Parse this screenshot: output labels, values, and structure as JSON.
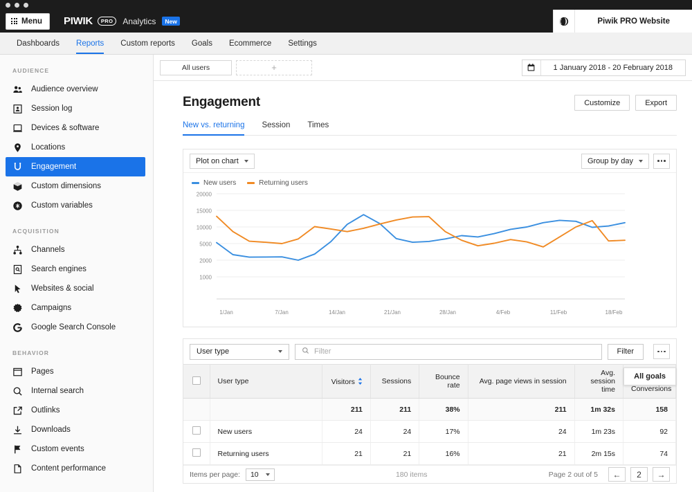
{
  "window": {
    "dots": 3
  },
  "topbar": {
    "menu_label": "Menu",
    "brand_piwik": "PIWIK",
    "brand_pro": "PRO",
    "brand_product": "Analytics",
    "brand_badge": "New",
    "globe_icon": "globe-icon",
    "site_name": "Piwik PRO Website"
  },
  "nav": {
    "tabs": [
      {
        "label": "Dashboards",
        "active": false
      },
      {
        "label": "Reports",
        "active": true
      },
      {
        "label": "Custom reports",
        "active": false
      },
      {
        "label": "Goals",
        "active": false
      },
      {
        "label": "Ecommerce",
        "active": false
      },
      {
        "label": "Settings",
        "active": false
      }
    ]
  },
  "sidebar": {
    "groups": [
      {
        "title": "AUDIENCE",
        "items": [
          {
            "label": "Audience overview",
            "icon": "users-icon",
            "active": false
          },
          {
            "label": "Session log",
            "icon": "session-log-icon",
            "active": false
          },
          {
            "label": "Devices & software",
            "icon": "device-icon",
            "active": false
          },
          {
            "label": "Locations",
            "icon": "pin-icon",
            "active": false
          },
          {
            "label": "Engagement",
            "icon": "engagement-icon",
            "active": true
          },
          {
            "label": "Custom dimensions",
            "icon": "cube-icon",
            "active": false
          },
          {
            "label": "Custom variables",
            "icon": "variables-icon",
            "active": false
          }
        ]
      },
      {
        "title": "ACQUISITION",
        "items": [
          {
            "label": "Channels",
            "icon": "channels-icon",
            "active": false
          },
          {
            "label": "Search engines",
            "icon": "search-engines-icon",
            "active": false
          },
          {
            "label": "Websites & social",
            "icon": "cursor-icon",
            "active": false
          },
          {
            "label": "Campaigns",
            "icon": "campaigns-icon",
            "active": false
          },
          {
            "label": "Google Search Console",
            "icon": "google-icon",
            "active": false
          }
        ]
      },
      {
        "title": "BEHAVIOR",
        "items": [
          {
            "label": "Pages",
            "icon": "pages-icon",
            "active": false
          },
          {
            "label": "Internal search",
            "icon": "search-icon",
            "active": false
          },
          {
            "label": "Outlinks",
            "icon": "outlink-icon",
            "active": false
          },
          {
            "label": "Downloads",
            "icon": "download-icon",
            "active": false
          },
          {
            "label": "Custom events",
            "icon": "flag-icon",
            "active": false
          },
          {
            "label": "Content performance",
            "icon": "document-icon",
            "active": false
          }
        ]
      }
    ]
  },
  "filterbar": {
    "segment_all": "All users",
    "segment_add": "+",
    "calendar_icon": "calendar-icon",
    "date_range": "1 January 2018 - 20 February 2018"
  },
  "page": {
    "title": "Engagement",
    "customize_label": "Customize",
    "export_label": "Export",
    "subtabs": [
      {
        "label": "New vs. returning",
        "active": true
      },
      {
        "label": "Session",
        "active": false
      },
      {
        "label": "Times",
        "active": false
      }
    ]
  },
  "chart_card": {
    "plot_select": "Plot on chart",
    "group_select": "Group by day",
    "more_icon": "kebab-icon"
  },
  "chart_data": {
    "type": "line",
    "title": "",
    "xlabel": "",
    "ylabel": "",
    "grid": true,
    "legend_position": "top-left",
    "x_tick_labels": [
      "1/Jan",
      "7/Jan",
      "14/Jan",
      "21/Jan",
      "28/Jan",
      "4/Feb",
      "11/Feb",
      "18/Feb"
    ],
    "y_tick_labels": [
      "20000",
      "15000",
      "10000",
      "5000",
      "2000",
      "1000"
    ],
    "y_tick_values": [
      20000,
      15000,
      10000,
      5000,
      2000,
      1000
    ],
    "y_scale": "nonlinear-custom",
    "series": [
      {
        "name": "New users",
        "color": "#3a8fe0",
        "values": [
          5300,
          3000,
          2550,
          2580,
          2600,
          2000,
          3100,
          5600,
          10800,
          13700,
          11000,
          6500,
          5400,
          5650,
          6400,
          7400,
          7000,
          8000,
          9300,
          10000,
          11300,
          12000,
          11700,
          9900,
          10300,
          11300
        ]
      },
      {
        "name": "Returning users",
        "color": "#f08a24",
        "values": [
          13200,
          8600,
          5700,
          5400,
          5000,
          6400,
          10100,
          9400,
          8600,
          9600,
          10900,
          12100,
          13000,
          13100,
          8600,
          6000,
          4600,
          5100,
          6200,
          5500,
          4400,
          7000,
          10000,
          11900,
          5800,
          6000
        ]
      }
    ]
  },
  "table_card": {
    "dimension_select": "User type",
    "filter_placeholder": "Filter",
    "filter_icon": "search-icon",
    "filter_button": "Filter",
    "more_icon": "kebab-icon",
    "goals_popover": "All goals",
    "columns": [
      {
        "key": "user_type",
        "label": "User type",
        "align": "left",
        "sorted": false
      },
      {
        "key": "visitors",
        "label": "Visitors",
        "align": "right",
        "sorted": true
      },
      {
        "key": "sessions",
        "label": "Sessions",
        "align": "right",
        "sorted": false
      },
      {
        "key": "bounce_rate",
        "label": "Bounce rate",
        "align": "right",
        "sorted": false
      },
      {
        "key": "avg_page_views",
        "label": "Avg. page views in session",
        "align": "right",
        "sorted": false
      },
      {
        "key": "avg_session_time",
        "label": "Avg. session time",
        "align": "right",
        "sorted": false
      },
      {
        "key": "conversions",
        "label": "Conversions",
        "align": "right",
        "sorted": false
      }
    ],
    "rows": [
      {
        "is_total": true,
        "user_type": "",
        "visitors": "211",
        "sessions": "211",
        "bounce_rate": "38%",
        "avg_page_views": "211",
        "avg_session_time": "1m 32s",
        "conversions": "158"
      },
      {
        "is_total": false,
        "user_type": "New users",
        "visitors": "24",
        "sessions": "24",
        "bounce_rate": "17%",
        "avg_page_views": "24",
        "avg_session_time": "1m 23s",
        "conversions": "92"
      },
      {
        "is_total": false,
        "user_type": "Returning users",
        "visitors": "21",
        "sessions": "21",
        "bounce_rate": "16%",
        "avg_page_views": "21",
        "avg_session_time": "2m 15s",
        "conversions": "74"
      }
    ],
    "footer": {
      "items_per_page_label": "Items per page:",
      "items_per_page_value": "10",
      "items_count": "180 items",
      "page_info": "Page 2 out of 5",
      "prev_icon": "arrow-left-icon",
      "current_page": "2",
      "next_icon": "arrow-right-icon"
    }
  },
  "colors": {
    "accent": "#1a73e8",
    "series_new": "#3a8fe0",
    "series_returning": "#f08a24",
    "chrome": "#1c1c1c"
  }
}
